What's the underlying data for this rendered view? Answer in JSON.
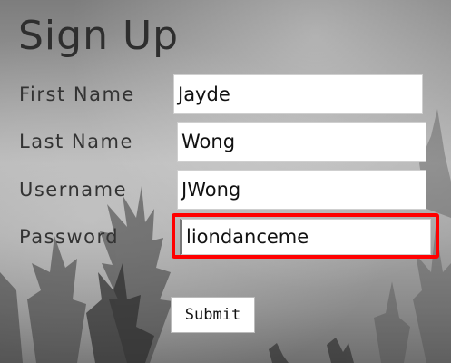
{
  "form": {
    "title": "Sign Up",
    "fields": [
      {
        "label": "First Name",
        "value": "Jayde"
      },
      {
        "label": "Last Name",
        "value": "Wong"
      },
      {
        "label": "Username",
        "value": "JWong"
      },
      {
        "label": "Password",
        "value": "liondanceme"
      }
    ],
    "submit_label": "Submit"
  },
  "highlight": {
    "color": "#ff0000",
    "target": "password-field"
  }
}
